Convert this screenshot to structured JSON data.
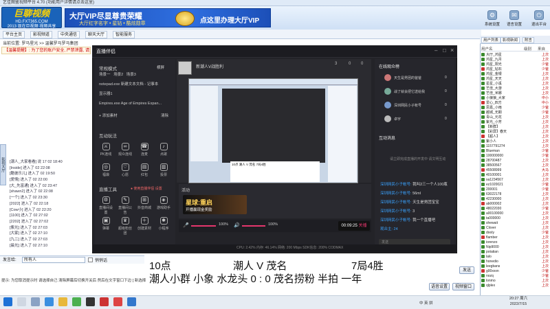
{
  "app": {
    "titlebar": "艺佳图鉴视频平台 4.70 (功能用户详情请点击这里)"
  },
  "banner": {
    "logo_text": "巨聊视频",
    "logo_sub": "HD.FXT365.COM",
    "logo_sub2": "2013 现在巨视频 视频共享",
    "vip_title": "大厅VIP尽显尊贵荣耀",
    "vip_sub": "大厅红字名字 • 星钻 • 酷炫勋章",
    "vip_cta": "点这里办理大厅VIP",
    "buttons": [
      {
        "label": "系统设置",
        "icon": "⚙"
      },
      {
        "label": "语言设置",
        "icon": "✉"
      },
      {
        "label": "充值",
        "icon": "$"
      },
      {
        "label": "退出平台",
        "icon": "⏻"
      }
    ]
  },
  "tabs": [
    "平台主页",
    "影视频道",
    "中央通信",
    "聊天大厅",
    "智能服务"
  ],
  "room_path": "当前位置: 罗马星光 >> 温馨罗马罗马集团",
  "notice": "【温馨提醒】: 为了您的账户安全, 严禁泄露, 请妥善保管",
  "side_strip": "影视大厅",
  "chat_lines": [
    "[潮人_大家看看] 说 17 02 18:40",
    "[Inside] 进入了 02 22:08",
    "[酷彼乐儿] 进入了 02 19:50",
    "[爱情] 进入了 02 22:00",
    "[大_先富通] 进入了 02 23:47",
    "[shawn2] 进入了 02 22:08",
    "[一个] 进入了 02 23:30",
    "[2022] 进入了 02 22:18",
    "[Cow小] 进入了 02 22:20",
    "[1100] 进入了 02 27:02",
    "[2202] 进入了 02 27:02",
    "[紫光] 进入了 02 27:03",
    "[大家] 进入了 02 27:10",
    "[九二] 进入了 02 27:03",
    "[晨光] 进入了 02 27:10"
  ],
  "input": {
    "label": "发言给:",
    "value": "所有人",
    "checkbox": "悄悄话"
  },
  "tips": "提示: 为您取消提示时 请选择自己 清除屏幕后切换开关后 然后在文字窗口下边 [ 新选择手机 ]",
  "right_panel": {
    "tabs": [
      "用户列表",
      "影视新闻",
      "附言"
    ],
    "cols": [
      "用户名",
      "级别",
      "来自"
    ],
    "users": [
      [
        "大厅_鸿星",
        "",
        "上次"
      ],
      [
        "鸿星_九月",
        "",
        "上次"
      ],
      [
        "鸿星_阳光",
        "",
        "少爸"
      ],
      [
        "鸿星_钻石",
        "",
        "少爸"
      ],
      [
        "鸿星_金银",
        "",
        "上次"
      ],
      [
        "鸿星_天天",
        "",
        "上次"
      ],
      [
        "星星_小溪",
        "",
        "上次"
      ],
      [
        "艺佳_大游",
        "",
        "上次"
      ],
      [
        "艺佳_米娜",
        "",
        "上次"
      ],
      [
        "小狼狼_大家",
        "",
        "中小"
      ],
      [
        "爱心_四方",
        "",
        "中小"
      ],
      [
        "思嘉_小雨",
        "",
        "少爸"
      ],
      [
        "越城_无期",
        "",
        "少爸"
      ],
      [
        "青山_元花",
        "",
        "上次"
      ],
      [
        "紫光_小芳",
        "",
        "上次"
      ],
      [
        "【新群】",
        "",
        "上次"
      ],
      [
        "【彩屏】春天",
        "",
        "上次"
      ],
      [
        "【超人】",
        "",
        "上次"
      ],
      [
        "紫小人",
        "",
        "上次"
      ],
      [
        "1157791274",
        "",
        "上次"
      ],
      [
        "Blueman",
        "",
        "少爸"
      ],
      [
        "100000000",
        "",
        "少爸"
      ],
      [
        "28700487",
        "",
        "上次"
      ],
      [
        "38500567",
        "",
        "上次"
      ],
      [
        "45508999",
        "",
        "大马"
      ],
      [
        "40100001",
        "",
        "上次"
      ],
      [
        "xa1234567",
        "",
        "上次"
      ],
      [
        "ez1020021",
        "",
        "少爸"
      ],
      [
        "200001",
        "",
        "少爸"
      ],
      [
        "63022178",
        "",
        "上次"
      ],
      [
        "42230000",
        "",
        "上次"
      ],
      [
        "ab000002",
        "",
        "上次"
      ],
      [
        "48022030",
        "",
        "少爸"
      ],
      [
        "a00100000",
        "",
        "上次"
      ],
      [
        "ta000000",
        "",
        "上次"
      ],
      [
        "shewait",
        "",
        "上次"
      ],
      [
        "Clover",
        "",
        "上次"
      ],
      [
        "dooly",
        "",
        "少爸"
      ],
      [
        "flamber",
        "",
        "上次"
      ],
      [
        "iorenzo",
        "",
        "上次"
      ],
      [
        "Nip9000",
        "",
        "上次"
      ],
      [
        "potatian",
        "",
        "上次"
      ],
      [
        "lalo",
        "",
        "上次"
      ],
      [
        "honedio",
        "",
        "上次"
      ],
      [
        "leegbans",
        "",
        "上次"
      ],
      [
        "g00xxxn",
        "",
        "少爸"
      ],
      [
        "nozq",
        "",
        "少爸"
      ],
      [
        "lonmo",
        "",
        "上次"
      ],
      [
        "qlplex",
        "",
        "上次"
      ]
    ]
  },
  "bottom_buttons": [
    "发送",
    "语音设置",
    "视频窗口",
    "调节音量"
  ],
  "live": {
    "title": "直播伴侣",
    "left": {
      "mode_label": "常规模式",
      "landscape": "横屏",
      "tags": [
        "场景一",
        "场景2",
        "场景3"
      ],
      "sources": [
        {
          "name": "notepad.exe 新建文本文档 - 记事本"
        },
        {
          "name": "显示器1"
        },
        {
          "name": "Empires.exe Age of Empires Expan..."
        }
      ],
      "add_source": "+ 添加素材",
      "clear": "清除",
      "interact_title": "互动玩法",
      "interact": [
        "PK连线",
        "观众连线",
        "连麦",
        "点歌",
        "福袋",
        "心愿",
        "红包",
        "投票"
      ],
      "tools_title": "直播工具",
      "tools_hint": "● 使用直播伴侣 设置",
      "tools": [
        "直播间设置",
        "直播间公告",
        "抖音商城",
        "游戏助手",
        "弹幕",
        "超级粉丝团",
        "创建素材",
        "小程序"
      ]
    },
    "scene": {
      "channel": "新潮人V战胜利",
      "likes": "3",
      "hearts": "0",
      "comments": "0"
    },
    "activity": {
      "title": "活动",
      "card_title": "星球:重启",
      "card_sub": "开播赢现金奖励"
    },
    "controls": {
      "mic": "100%",
      "speaker": "100%",
      "timer": "00:09:25",
      "end": "关播"
    },
    "right": {
      "audience_title": "在线观众榜",
      "audience": [
        {
          "name": "天生是男团的爸爸",
          "score": "0"
        },
        {
          "name": "战了就会把它送给我",
          "score": "0"
        },
        {
          "name": "深圳网民小子帐号",
          "score": "0"
        },
        {
          "name": "卓宇",
          "score": "0"
        }
      ],
      "chat_title": "互动消息",
      "chat_hint": "请立即完成直播的开发中 请文明互动",
      "messages": [
        {
          "user": "深圳网民小子帐号:",
          "text": "我叫2三一个人100瓶"
        },
        {
          "user": "深圳网民小子帐号:",
          "text": "56ml"
        },
        {
          "user": "深圳网民小子帐号:",
          "text": "天生是男团宝宝"
        },
        {
          "user": "深圳网民小子帐号:",
          "text": "3"
        },
        {
          "user": "深圳网民小子帐号:",
          "text": "我一个直播吧"
        },
        {
          "user": "观众主: 24",
          "text": ""
        }
      ],
      "input_placeholder": "发送"
    },
    "status": "CPU: 2.42%  内存: 46.14%  网络: 200 Mbps  SDK信息:  200%  CODMAX"
  },
  "overlay": {
    "line1_left": "10点",
    "line1_mid": "潮人 V 茂名",
    "line1_right": "7局4胜",
    "line2": "潮人小群  小象  水龙头 0 :   0    茂名捞粉  半拍  一年"
  },
  "taskbar": {
    "time": "20:27 周六",
    "date": "2022/7/15",
    "ime": "中 英 拼"
  }
}
